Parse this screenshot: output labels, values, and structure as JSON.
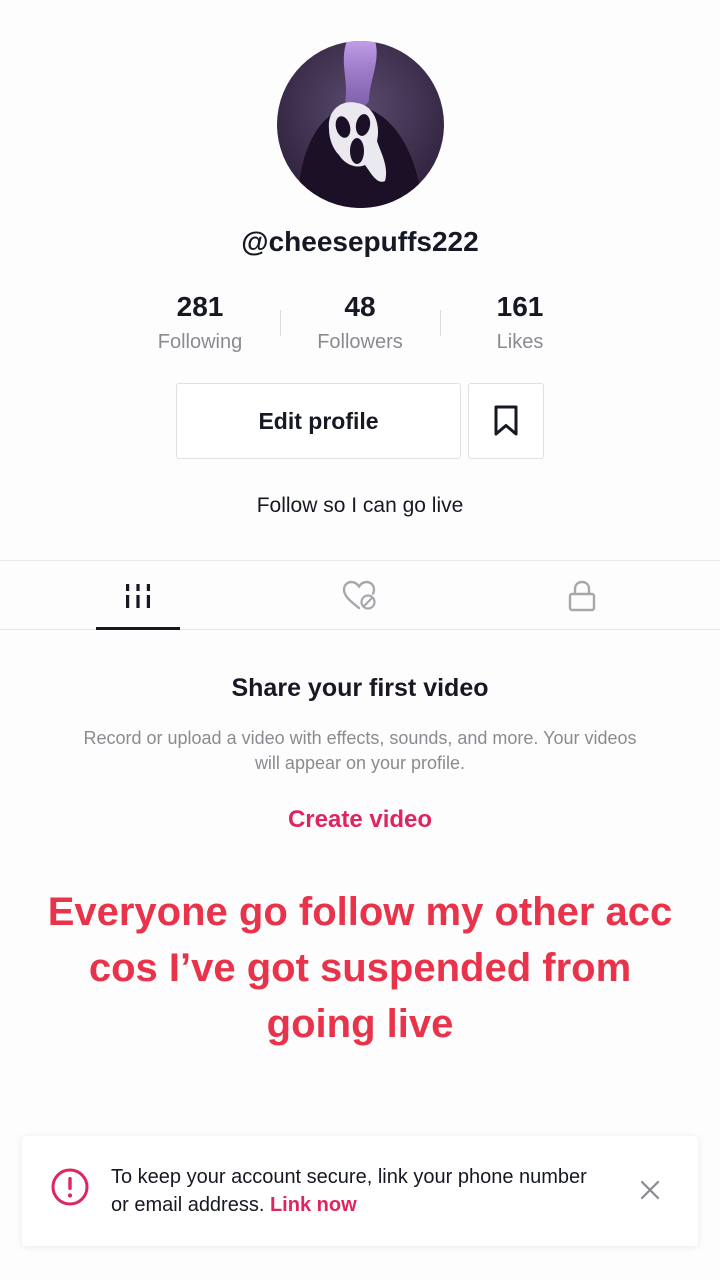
{
  "profile": {
    "username": "@cheesepuffs222",
    "bio": "Follow so I can go live",
    "avatar_icon": "ghostface-avatar"
  },
  "stats": [
    {
      "value": "281",
      "label": "Following"
    },
    {
      "value": "48",
      "label": "Followers"
    },
    {
      "value": "161",
      "label": "Likes"
    }
  ],
  "actions": {
    "edit_profile_label": "Edit profile",
    "bookmark_icon": "bookmark-icon"
  },
  "tabs": [
    {
      "icon": "grid-videos-icon",
      "active": true
    },
    {
      "icon": "liked-hidden-icon",
      "active": false
    },
    {
      "icon": "lock-icon",
      "active": false
    }
  ],
  "empty_state": {
    "title": "Share your first video",
    "description": "Record or upload a video with effects, sounds, and more. Your videos will appear on your profile.",
    "cta": "Create video"
  },
  "overlay_caption": "Everyone go follow my other acc cos I’ve got suspended from going live",
  "banner": {
    "text": "To keep your account secure, link your phone number or email address.",
    "link": "Link now",
    "icon": "alert-circle-icon"
  },
  "colors": {
    "accent": "#e0245e",
    "caption": "#e8334a",
    "text": "#161823",
    "muted": "#8a8b91"
  }
}
